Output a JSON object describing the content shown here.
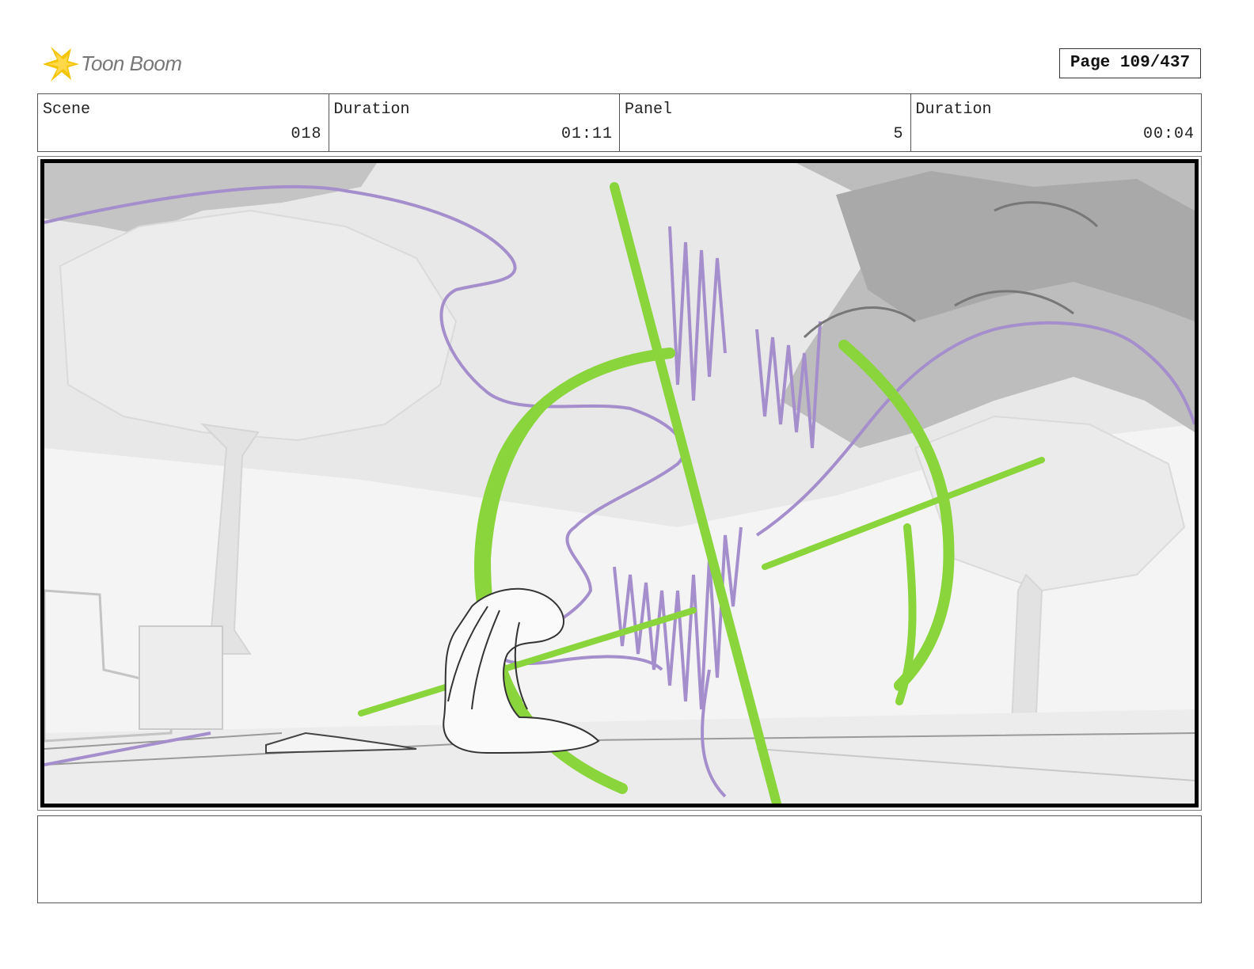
{
  "header": {
    "logo_text": "Toon Boom",
    "page_label": "Page 109/437"
  },
  "info": {
    "scene_label": "Scene",
    "scene_value": "018",
    "scene_duration_label": "Duration",
    "scene_duration_value": "01:11",
    "panel_label": "Panel",
    "panel_value": "5",
    "panel_duration_label": "Duration",
    "panel_duration_value": "00:04"
  },
  "colors": {
    "logo_yellow": "#f5c400",
    "action_green": "#8ad43c",
    "layout_purple": "#a48fcc"
  },
  "notes": {
    "text": ""
  }
}
